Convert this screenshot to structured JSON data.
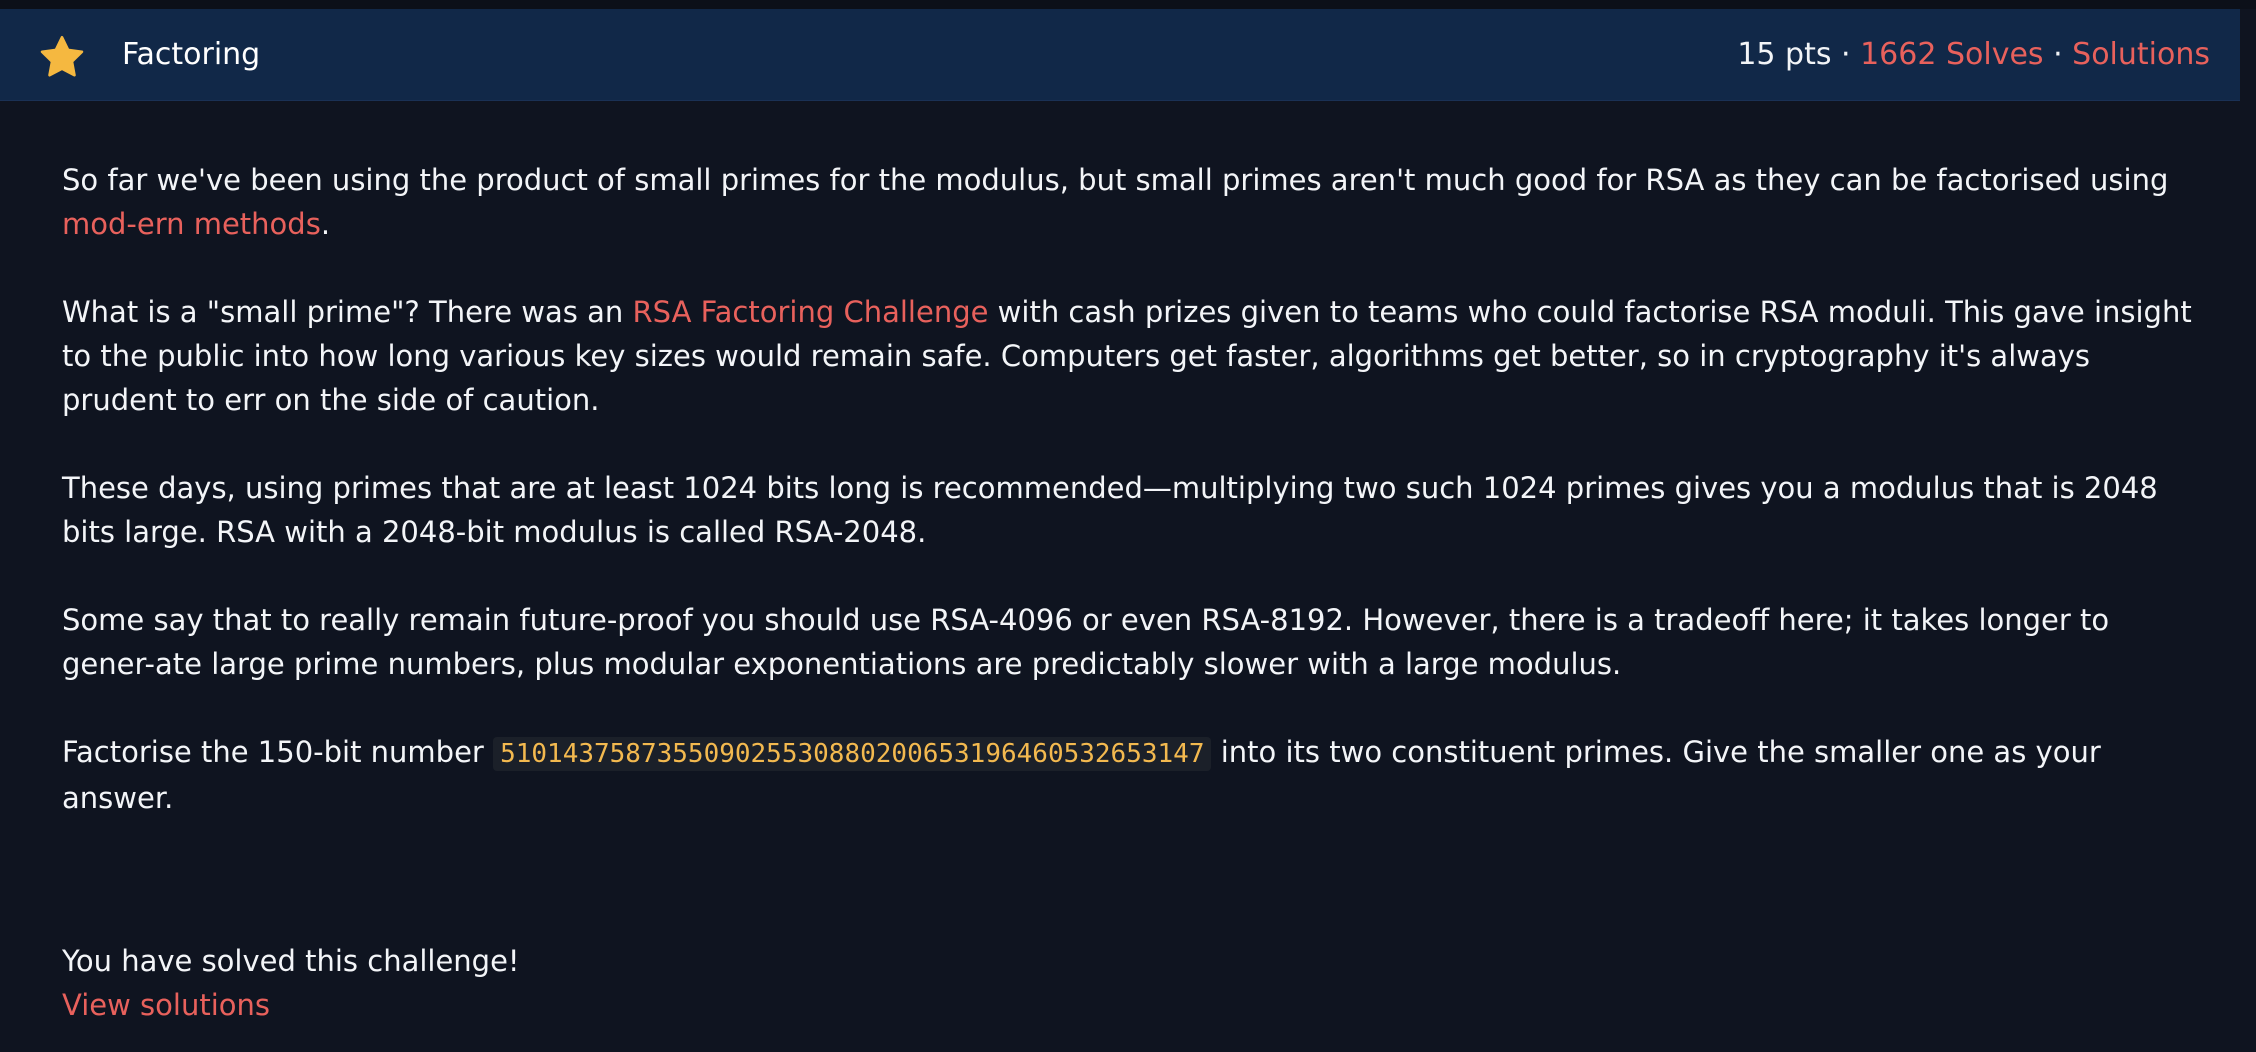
{
  "colors": {
    "background": "#0f1420",
    "header": "#112848",
    "link": "#e8615c",
    "code": "#f3b94f",
    "star": "#f5b840"
  },
  "header": {
    "icon": "star-icon",
    "title": "Factoring",
    "points": "15 pts",
    "separator": " · ",
    "solves": "1662 Solves",
    "solutions": "Solutions"
  },
  "content": {
    "p1": {
      "text": "So far we've been using the product of small primes for the modulus, but small primes aren't much good for RSA as they can be factorised using ",
      "link": "mod-ern methods",
      "end": "."
    },
    "p2": {
      "before": "What is a \"small prime\"? There was an ",
      "link": "RSA Factoring Challenge",
      "after": " with cash prizes given to teams who could factorise RSA moduli. This gave insight to the public into how long various key sizes would remain safe. Computers get faster, algorithms get better, so in cryptography it's always prudent to err on the side of caution."
    },
    "p3": "These days, using primes that are at least 1024 bits long is recommended—multiplying two such 1024 primes gives you a modulus that is 2048 bits large. RSA with a 2048-bit modulus is called RSA-2048.",
    "p4": "Some say that to really remain future-proof you should use RSA-4096 or even RSA-8192. However, there is a tradeoff here; it takes longer to gener-ate large prime numbers, plus modular exponentiations are predictably slower with a large modulus.",
    "p5": {
      "before": "Factorise the 150-bit number ",
      "code": "510143758735509025530880200653196460532653147",
      "after": " into its two constituent primes. Give the smaller one as your answer."
    }
  },
  "status": {
    "solved_text": "You have solved this challenge!",
    "view_solutions": "View solutions"
  }
}
